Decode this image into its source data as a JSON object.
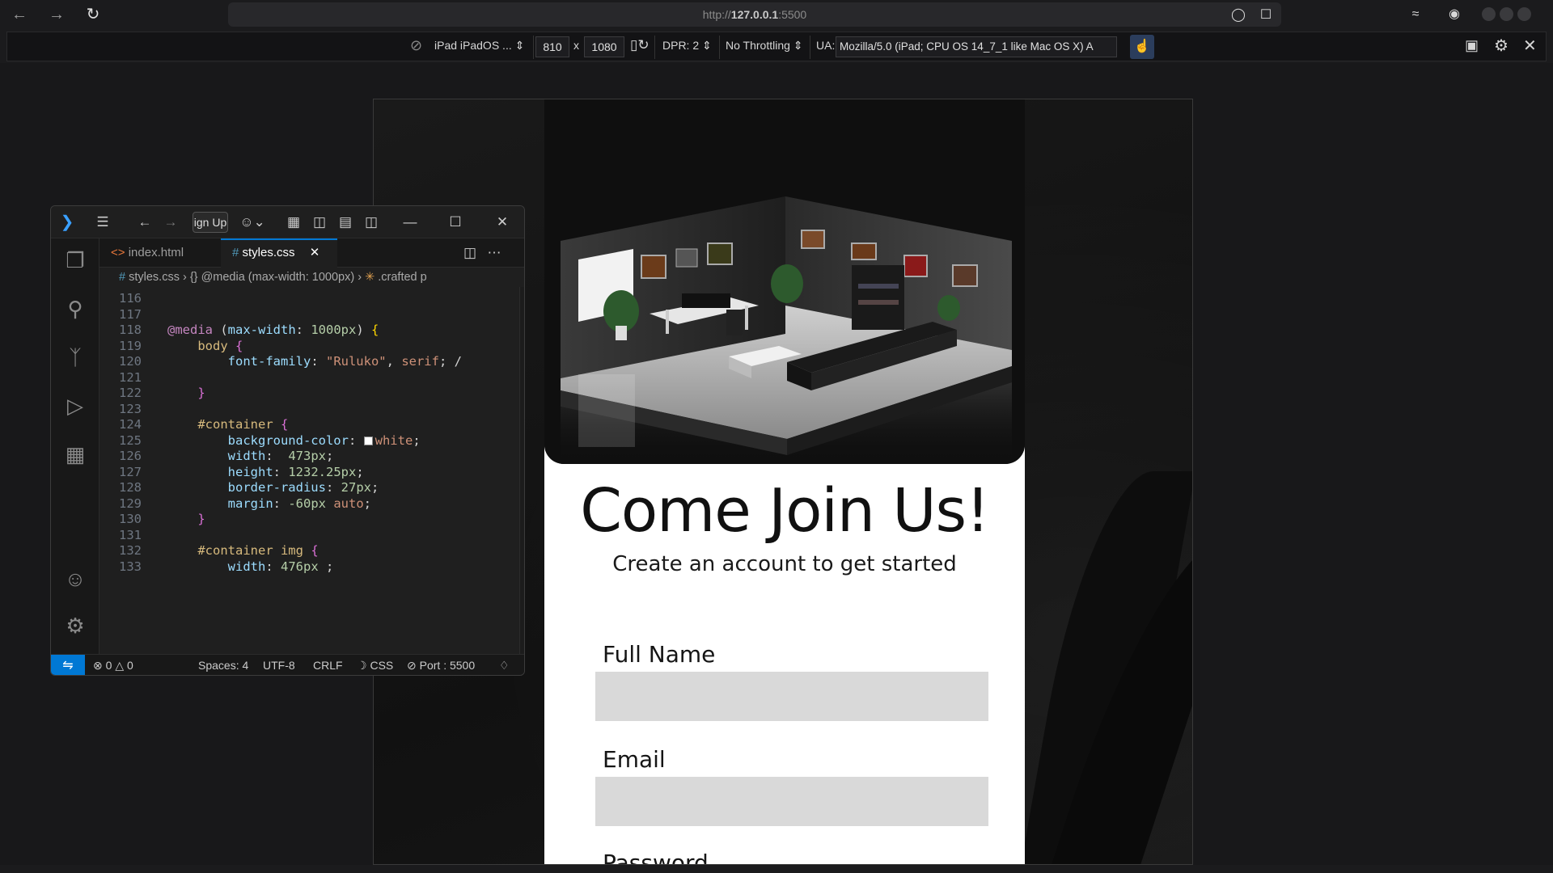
{
  "browser": {
    "url_prefix": "http://",
    "url_host": "127.0.0.1",
    "url_port": ":5500"
  },
  "responsive_toolbar": {
    "device": "iPad iPadOS ...",
    "width": "810",
    "times": "x",
    "height": "1080",
    "dpr": "DPR: 2",
    "throttling": "No Throttling",
    "ua_label": "UA:",
    "ua_value": "Mozilla/5.0 (iPad; CPU OS 14_7_1 like Mac OS X) A"
  },
  "signup_page": {
    "title": "Come Join Us!",
    "subtitle": "Create an account to get started",
    "fields": [
      {
        "label": "Full Name",
        "value": ""
      },
      {
        "label": "Email",
        "value": ""
      },
      {
        "label": "Password",
        "value": ""
      }
    ]
  },
  "vscode": {
    "command_center": "ign Up",
    "tabs": [
      {
        "label": "index.html",
        "icon": "<>"
      },
      {
        "label": "styles.css",
        "icon": "#",
        "active": true
      }
    ],
    "breadcrumb": {
      "file": "styles.css",
      "media": "@media (max-width: 1000px)",
      "selector": ".crafted p"
    },
    "code_lines": [
      {
        "num": "116",
        "text": ""
      },
      {
        "num": "117",
        "text": ""
      },
      {
        "num": "118",
        "text": "@media (max-width: 1000px) {"
      },
      {
        "num": "119",
        "text": "    body {"
      },
      {
        "num": "120",
        "text": "        font-family: \"Ruluko\", serif; /"
      },
      {
        "num": "121",
        "text": ""
      },
      {
        "num": "122",
        "text": "    }"
      },
      {
        "num": "123",
        "text": ""
      },
      {
        "num": "124",
        "text": "    #container {"
      },
      {
        "num": "125",
        "text": "        background-color: ■white;"
      },
      {
        "num": "126",
        "text": "        width:  473px;"
      },
      {
        "num": "127",
        "text": "        height: 1232.25px;"
      },
      {
        "num": "128",
        "text": "        border-radius: 27px;"
      },
      {
        "num": "129",
        "text": "        margin: -60px auto;"
      },
      {
        "num": "130",
        "text": "    }"
      },
      {
        "num": "131",
        "text": ""
      },
      {
        "num": "132",
        "text": "    #container img {"
      },
      {
        "num": "133",
        "text": "        width: 476px ;"
      }
    ],
    "status": {
      "errors": "0",
      "warnings": "0",
      "spaces": "Spaces: 4",
      "encoding": "UTF-8",
      "eol": "CRLF",
      "language": "CSS",
      "port": "Port : 5500"
    }
  },
  "colors": {
    "accent": "#0078d4",
    "input_bg": "#d9d9d9",
    "page_bg": "#ffffff"
  }
}
